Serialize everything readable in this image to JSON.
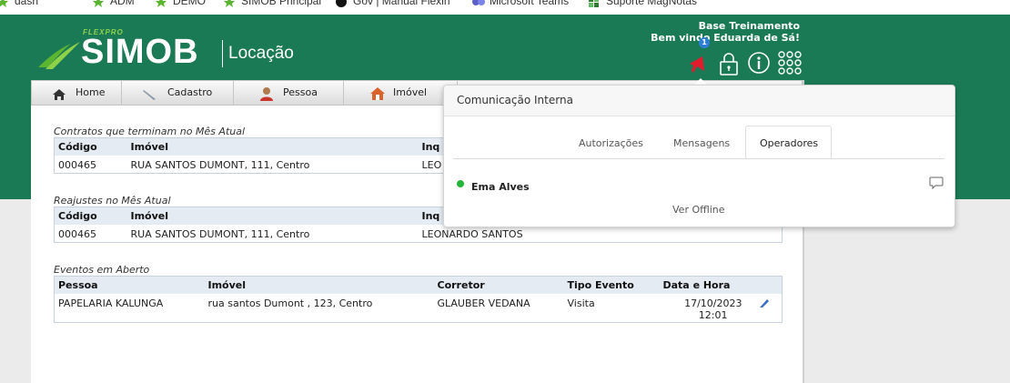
{
  "bookmarks": [
    {
      "label": "dash",
      "icon": "star-green-icon"
    },
    {
      "label": "ADM",
      "icon": "star-green-icon"
    },
    {
      "label": "DEMO",
      "icon": "star-green-icon"
    },
    {
      "label": "SIMOB Principal",
      "icon": "star-green-icon"
    },
    {
      "label": "Gov | Manual Flexin",
      "icon": "github-icon"
    },
    {
      "label": "Microsoft Teams",
      "icon": "teams-icon"
    },
    {
      "label": "Suporte MagNotas",
      "icon": "magnotas-icon"
    }
  ],
  "header": {
    "logo_small": "FLEXPRO",
    "logo_main": "SIMOB",
    "logo_sub": "Locação",
    "company": "Base Treinamento",
    "welcome": "Bem vindo Eduarda de Sá!",
    "notification_count": "1",
    "colors": {
      "background": "#1b7a56",
      "logo_accent": "#8ed24a"
    }
  },
  "menu": [
    {
      "label": "Home",
      "icon": "home-icon"
    },
    {
      "label": "Cadastro",
      "icon": "pen-icon"
    },
    {
      "label": "Pessoa",
      "icon": "person-icon"
    },
    {
      "label": "Imóvel",
      "icon": "house-icon"
    }
  ],
  "sections": {
    "contracts": {
      "title": "Contratos que terminam no Mês Atual",
      "columns": [
        "Código",
        "Imóvel",
        "Inq"
      ],
      "rows": [
        [
          "000465",
          "RUA SANTOS DUMONT, 111, Centro",
          "LEO"
        ]
      ]
    },
    "adjustments": {
      "title": "Reajustes no Mês Atual",
      "columns": [
        "Código",
        "Imóvel",
        "Inq"
      ],
      "rows": [
        [
          "000465",
          "RUA SANTOS DUMONT, 111, Centro",
          "LEONARDO SANTOS"
        ]
      ]
    },
    "events": {
      "title": "Eventos em Aberto",
      "columns": [
        "Pessoa",
        "Imóvel",
        "Corretor",
        "Tipo Evento",
        "Data e Hora"
      ],
      "rows": [
        [
          "PAPELARIA KALUNGA",
          "rua santos Dumont , 123, Centro",
          "GLAUBER VEDANA",
          "Visita",
          "17/10/2023",
          "12:01"
        ]
      ]
    }
  },
  "popup": {
    "title": "Comunicação Interna",
    "tabs": [
      "Autorizações",
      "Mensagens",
      "Operadores"
    ],
    "active_tab": "Operadores",
    "operators": [
      {
        "name": "Ema Alves",
        "status": "online"
      }
    ],
    "offline_link": "Ver Offline"
  }
}
